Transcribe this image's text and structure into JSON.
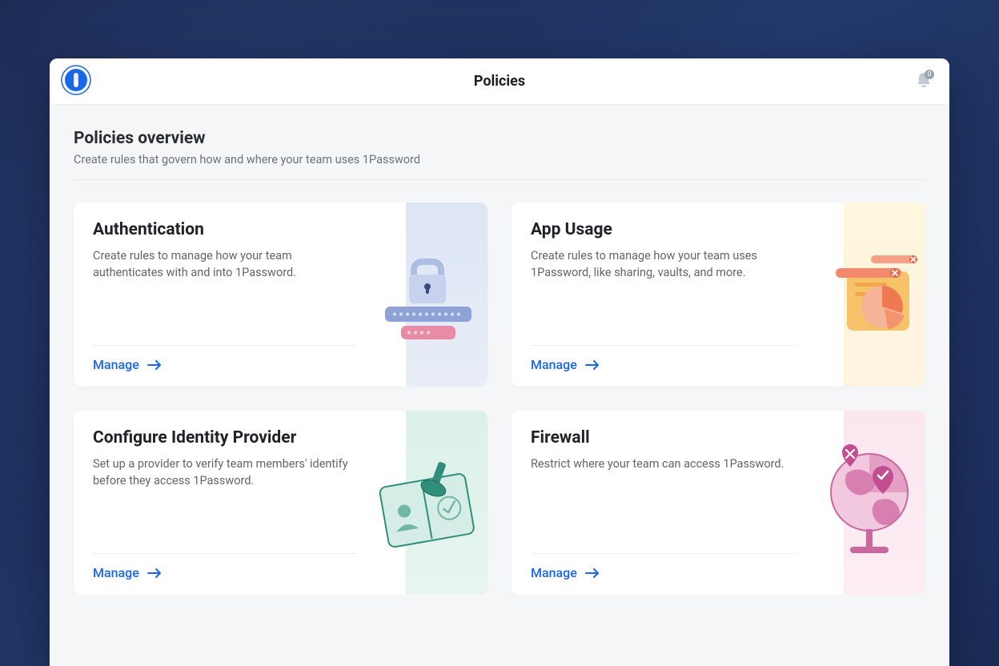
{
  "header": {
    "title": "Policies",
    "notification_count": "0"
  },
  "overview": {
    "title": "Policies overview",
    "subtitle": "Create rules that govern how and where your team uses 1Password"
  },
  "cards": [
    {
      "title": "Authentication",
      "description": "Create rules to manage how your team authenticates with and into 1Password.",
      "action": "Manage"
    },
    {
      "title": "App Usage",
      "description": "Create rules to manage how your team uses 1Password, like sharing, vaults, and more.",
      "action": "Manage"
    },
    {
      "title": "Configure Identity Provider",
      "description": "Set up a provider to verify team members' identify before they access 1Password.",
      "action": "Manage"
    },
    {
      "title": "Firewall",
      "description": "Restrict where your team can access 1Password.",
      "action": "Manage"
    }
  ]
}
